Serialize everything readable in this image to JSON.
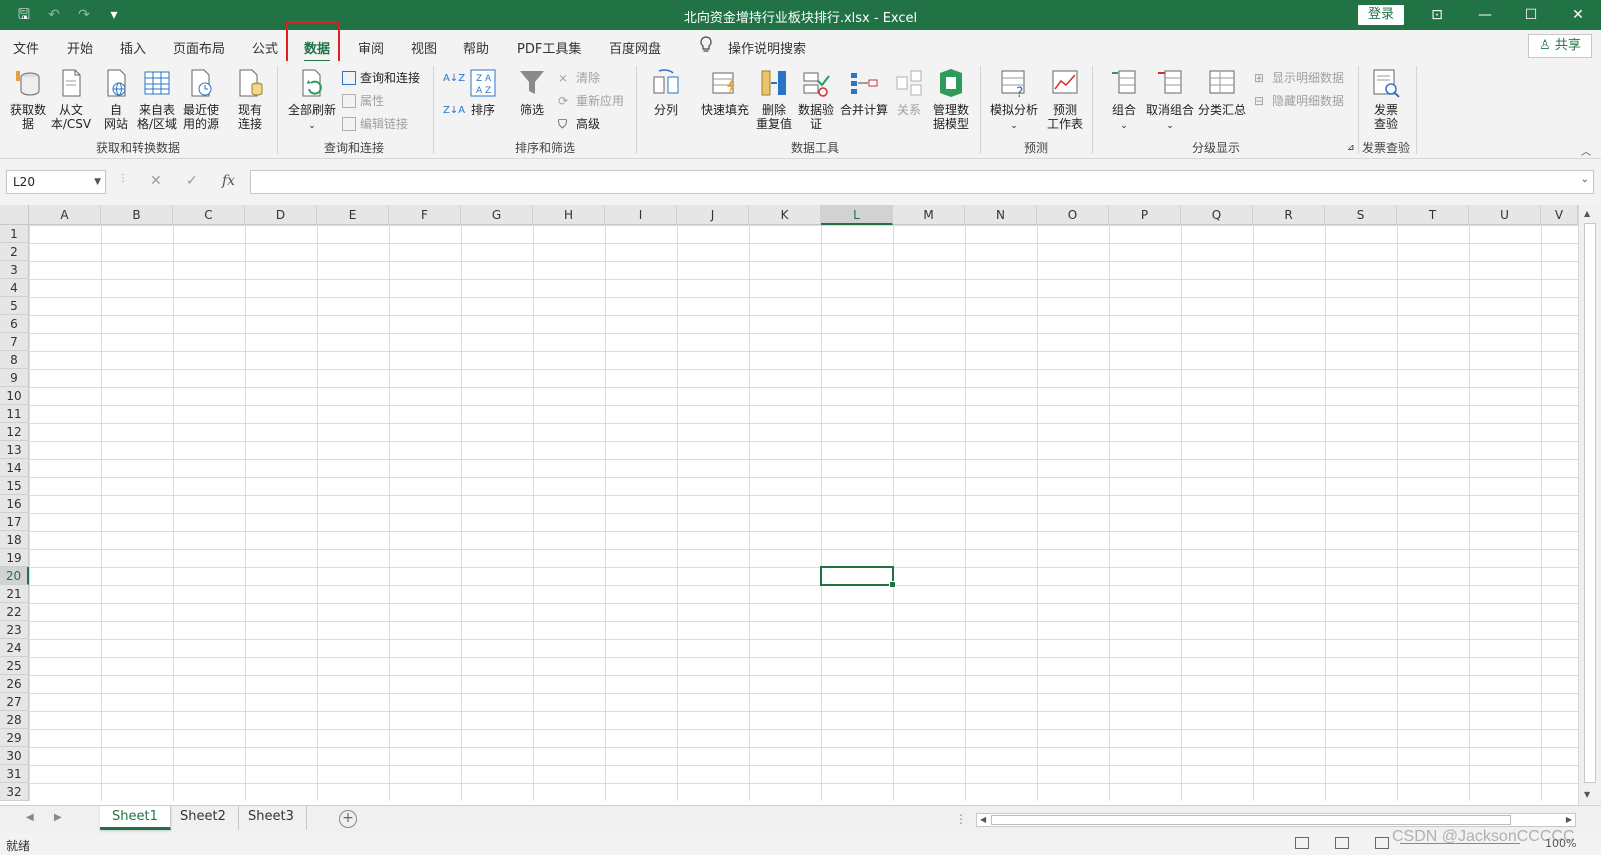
{
  "titlebar": {
    "title": "北向资金增持行业板块排行.xlsx  -  Excel",
    "login": "登录",
    "qat": {
      "save": "🖫",
      "undo": "↶",
      "redo": "↷",
      "customize": "▾"
    },
    "win": {
      "ribbon_display": "⊡",
      "minimize": "—",
      "maximize": "☐",
      "close": "✕"
    }
  },
  "tabs": [
    {
      "label": "文件"
    },
    {
      "label": "开始"
    },
    {
      "label": "插入"
    },
    {
      "label": "页面布局"
    },
    {
      "label": "公式"
    },
    {
      "label": "数据"
    },
    {
      "label": "审阅"
    },
    {
      "label": "视图"
    },
    {
      "label": "帮助"
    },
    {
      "label": "PDF工具集"
    },
    {
      "label": "百度网盘"
    }
  ],
  "tell_me": {
    "icon": "lightbulb-icon",
    "label": "操作说明搜索"
  },
  "share": "♙ 共享",
  "ribbon": {
    "get_data": "获取数\n据",
    "from_text": "从文\n本/CSV",
    "from_web": "自\n网站",
    "from_table": "来自表\n格/区域",
    "recent_sources": "最近使\n用的源",
    "existing_conn": "现有\n连接",
    "group_get": "获取和转换数据",
    "refresh_all": "全部刷新",
    "queries_conn": "查询和连接",
    "properties": "属性",
    "edit_links": "编辑链接",
    "group_queries": "查询和连接",
    "sort": "排序",
    "filter": "筛选",
    "clear": "清除",
    "reapply": "重新应用",
    "advanced": "高级",
    "group_sort": "排序和筛选",
    "text_to_columns": "分列",
    "flash_fill": "快速填充",
    "remove_dup": "删除\n重复值",
    "data_validation": "数据验\n证",
    "consolidate": "合并计算",
    "relationships": "关系",
    "data_model": "管理数\n据模型",
    "group_tools": "数据工具",
    "what_if": "模拟分析",
    "forecast_sheet": "预测\n工作表",
    "group_forecast": "预测",
    "group": "组合",
    "ungroup": "取消组合",
    "subtotal": "分类汇总",
    "show_detail": "显示明细数据",
    "hide_detail": "隐藏明细数据",
    "group_outline": "分级显示",
    "invoice_check": "发票\n查验",
    "group_invoice": "发票查验"
  },
  "formula_bar": {
    "name_box": "L20",
    "cancel": "✕",
    "enter": "✓",
    "fx": "fx",
    "formula": ""
  },
  "columns": [
    "A",
    "B",
    "C",
    "D",
    "E",
    "F",
    "G",
    "H",
    "I",
    "J",
    "K",
    "L",
    "M",
    "N",
    "O",
    "P",
    "Q",
    "R",
    "S",
    "T",
    "U",
    "V"
  ],
  "rows": [
    "1",
    "2",
    "3",
    "4",
    "5",
    "6",
    "7",
    "8",
    "9",
    "10",
    "11",
    "12",
    "13",
    "14",
    "15",
    "16",
    "17",
    "18",
    "19",
    "20",
    "21",
    "22",
    "23",
    "24",
    "25",
    "26",
    "27",
    "28",
    "29",
    "30",
    "31",
    "32"
  ],
  "selected": {
    "col": "L",
    "row": "20"
  },
  "sheets": [
    {
      "label": "Sheet1"
    },
    {
      "label": "Sheet2"
    },
    {
      "label": "Sheet3"
    }
  ],
  "status": {
    "ready": "就绪",
    "zoom": "100%"
  },
  "watermark": "CSDN @JacksonCCCCC"
}
